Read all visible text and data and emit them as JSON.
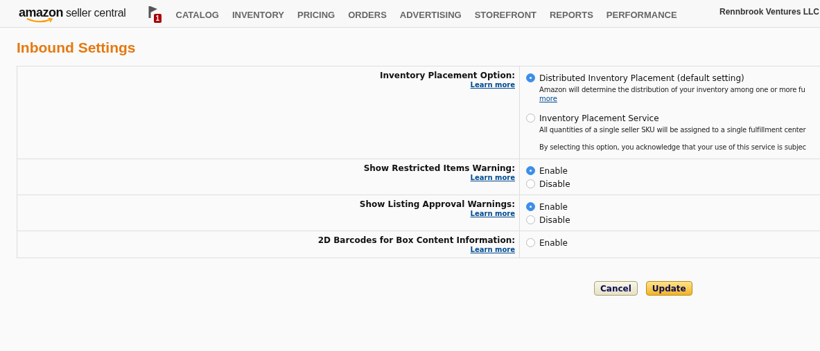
{
  "header": {
    "logo": {
      "brand": "amazon",
      "product": "seller central"
    },
    "notification_count": "1",
    "nav": [
      "CATALOG",
      "INVENTORY",
      "PRICING",
      "ORDERS",
      "ADVERTISING",
      "STOREFRONT",
      "REPORTS",
      "PERFORMANCE"
    ],
    "account": "Rennbrook Ventures LLC"
  },
  "page_title": "Inbound Settings",
  "settings": [
    {
      "label": "Inventory Placement Option:",
      "link": "Learn more",
      "options": [
        {
          "label": "Distributed Inventory Placement (default setting)",
          "selected": true,
          "description": [
            "Amazon will determine the distribution of your inventory among one or more fu"
          ],
          "link": "more"
        },
        {
          "label": "Inventory Placement Service",
          "selected": false,
          "description": [
            "All quantities of a single seller SKU will be assigned to a single fulfillment center",
            "By selecting this option, you acknowledge that your use of this service is subjec"
          ]
        }
      ]
    },
    {
      "label": "Show Restricted Items Warning:",
      "link": "Learn more",
      "options": [
        {
          "label": "Enable",
          "selected": true
        },
        {
          "label": "Disable",
          "selected": false
        }
      ]
    },
    {
      "label": "Show Listing Approval Warnings:",
      "link": "Learn more",
      "options": [
        {
          "label": "Enable",
          "selected": true
        },
        {
          "label": "Disable",
          "selected": false
        }
      ]
    },
    {
      "label": "2D Barcodes for Box Content Information:",
      "link": "Learn more",
      "options": [
        {
          "label": "Enable",
          "selected": false
        }
      ]
    }
  ],
  "buttons": [
    {
      "label": "Cancel",
      "kind": "secondary"
    },
    {
      "label": "Update",
      "kind": "primary"
    }
  ]
}
